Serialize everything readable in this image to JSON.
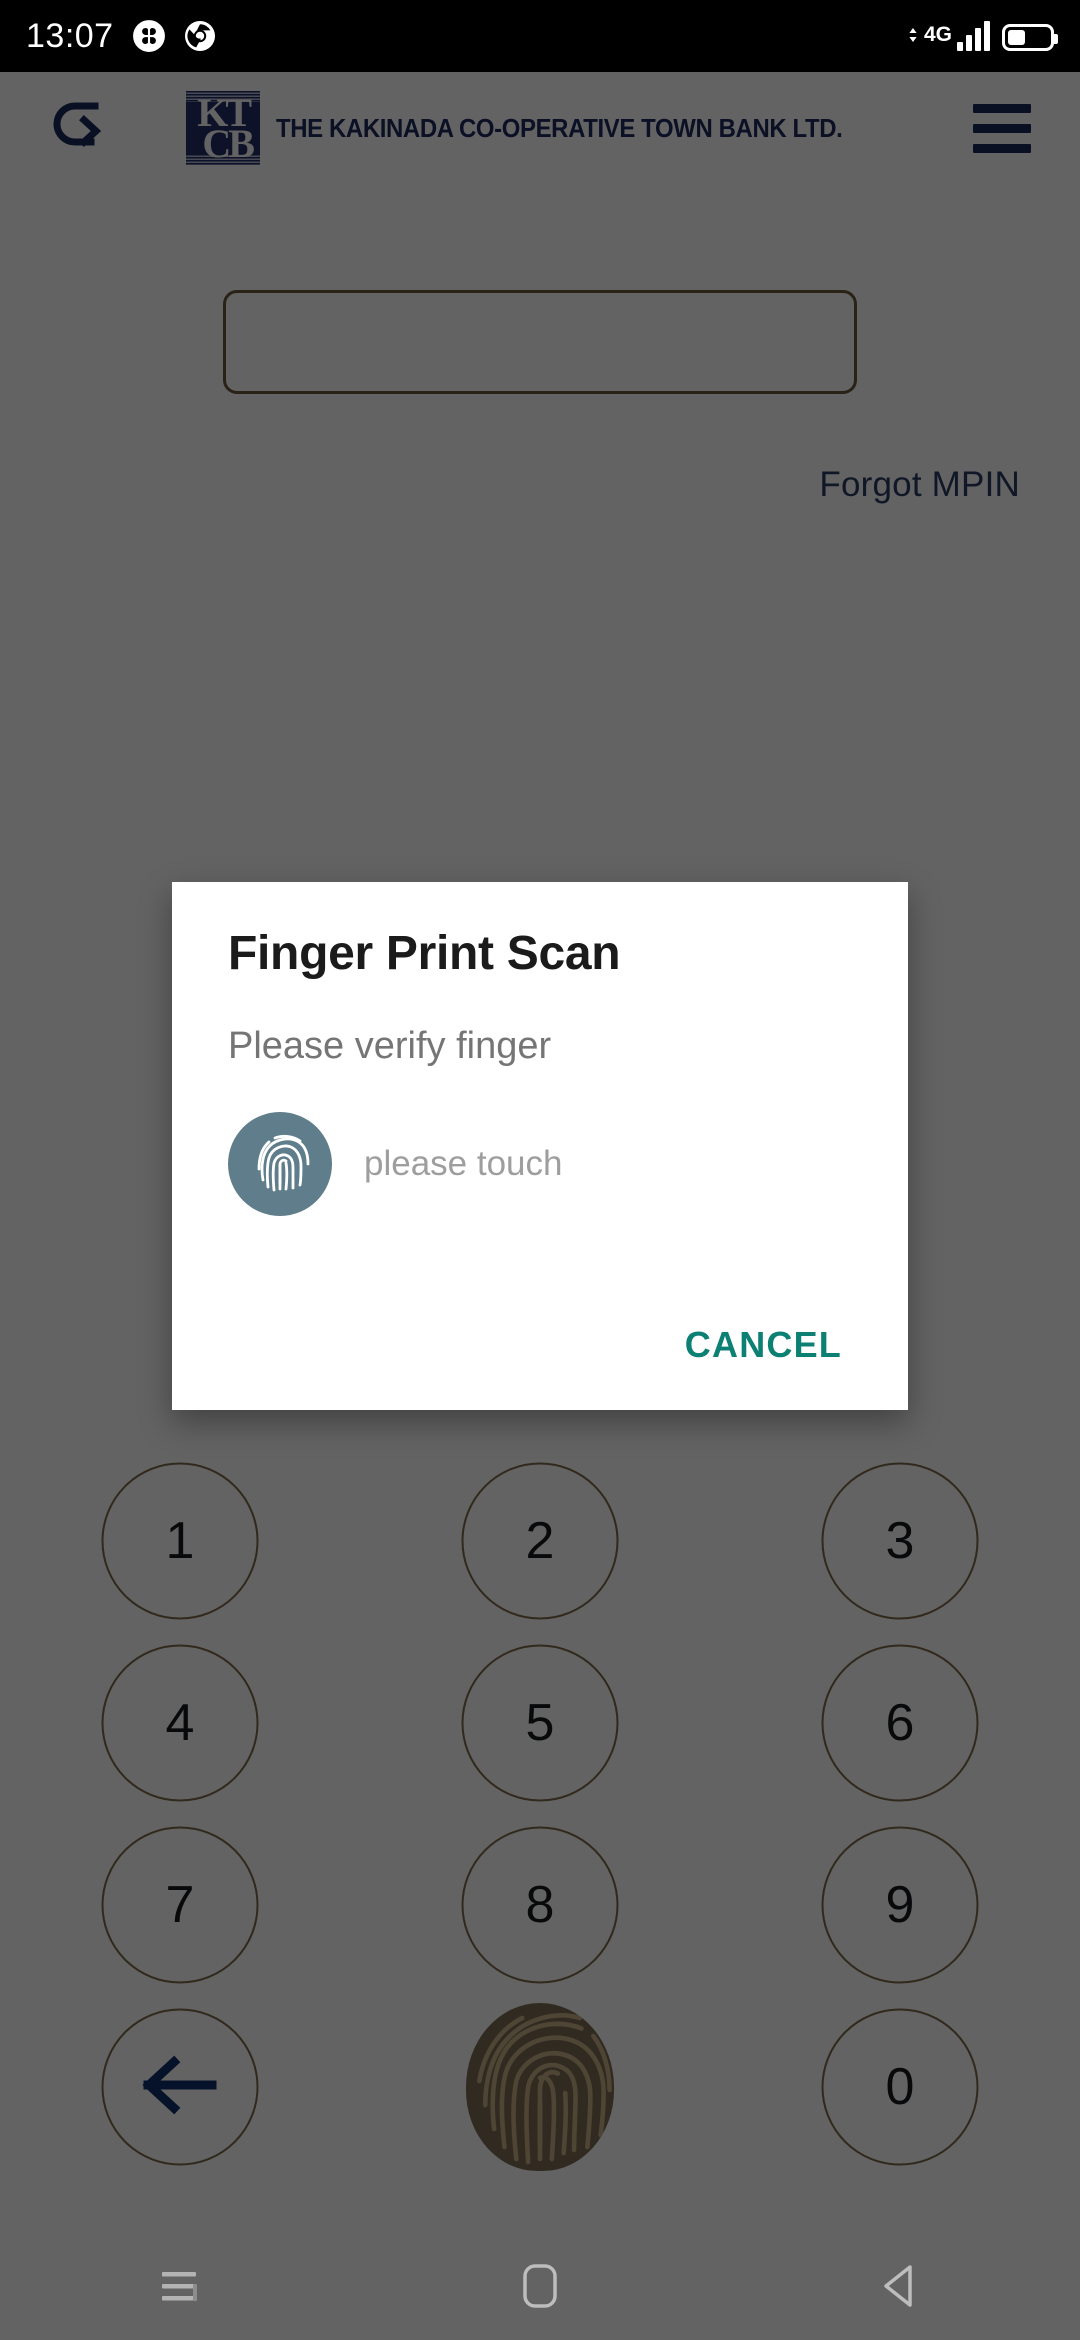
{
  "status_bar": {
    "time": "13:07",
    "icons_left": [
      "clover-app-icon",
      "chrome-icon"
    ],
    "network_generation": "4G",
    "icons_right": [
      "data-transfer-arrows-icon",
      "signal-bars-icon",
      "battery-icon"
    ],
    "battery_level_percent": 38
  },
  "header": {
    "refresh_icon": "refresh-rotate-icon",
    "logo_monogram_line1": "KT",
    "logo_monogram_line2": "CB",
    "bank_name": "THE KAKINADA CO-OPERATIVE TOWN BANK LTD.",
    "menu_icon": "hamburger-menu-icon"
  },
  "login": {
    "mpin_value": "",
    "mpin_placeholder": "",
    "forgot_link": "Forgot MPIN"
  },
  "keypad": {
    "keys": [
      {
        "label": "1",
        "type": "digit"
      },
      {
        "label": "2",
        "type": "digit"
      },
      {
        "label": "3",
        "type": "digit"
      },
      {
        "label": "4",
        "type": "digit"
      },
      {
        "label": "5",
        "type": "digit"
      },
      {
        "label": "6",
        "type": "digit"
      },
      {
        "label": "7",
        "type": "digit"
      },
      {
        "label": "8",
        "type": "digit"
      },
      {
        "label": "9",
        "type": "digit"
      },
      {
        "label": "",
        "type": "backspace",
        "icon": "back-arrow-icon"
      },
      {
        "label": "",
        "type": "fingerprint",
        "icon": "fingerprint-icon"
      },
      {
        "label": "0",
        "type": "digit"
      }
    ]
  },
  "dialog": {
    "title": "Finger Print Scan",
    "subtitle": "Please verify finger",
    "fingerprint_icon": "fingerprint-icon",
    "hint": "please touch",
    "cancel_label": "CANCEL"
  },
  "nav_bar": {
    "recents_icon": "recents-icon",
    "home_icon": "home-icon",
    "back_icon": "back-triangle-icon"
  },
  "colors": {
    "brand_navy": "#23306b",
    "keypad_ring": "#7d6a4a",
    "accent_teal": "#0d8074",
    "fingerprint_badge": "#5f7d8b",
    "scrim": "rgba(0,0,0,0.61)",
    "status_bar_bg": "#000000"
  }
}
